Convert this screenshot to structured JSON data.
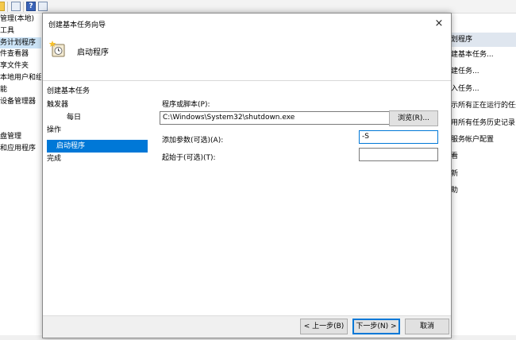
{
  "background": {
    "tree_items": [
      "管理(本地)",
      "工具",
      "务计划程序",
      "件查看器",
      "享文件夹",
      "本地用户和组",
      "能",
      "设备管理器",
      "",
      "",
      "盘管理",
      "和应用程序"
    ],
    "tree_selected_index": 2,
    "actions_header": "划程序",
    "actions_items": [
      "建基本任务...",
      "建任务...",
      "入任务...",
      "示所有正在运行的任务",
      "用所有任务历史记录",
      "服务帐户配置",
      "看",
      "新",
      "助"
    ]
  },
  "dialog": {
    "title": "创建基本任务向导",
    "close_glyph": "×",
    "header_title": "启动程序",
    "steps_heading": "创建基本任务",
    "steps": [
      {
        "label": "触发器"
      },
      {
        "label": "每日"
      },
      {
        "label": "操作"
      },
      {
        "label": "启动程序"
      },
      {
        "label": "完成"
      }
    ],
    "selected_step": "启动程序",
    "fields": {
      "program_label": "程序或脚本(P):",
      "program_value": "C:\\Windows\\System32\\shutdown.exe",
      "browse_label": "浏览(R)...",
      "args_label": "添加参数(可选)(A):",
      "args_value": "-S",
      "start_label": "起始于(可选)(T):",
      "start_value": ""
    },
    "buttons": {
      "back": "< 上一步(B)",
      "next": "下一步(N) >",
      "cancel": "取消"
    }
  }
}
